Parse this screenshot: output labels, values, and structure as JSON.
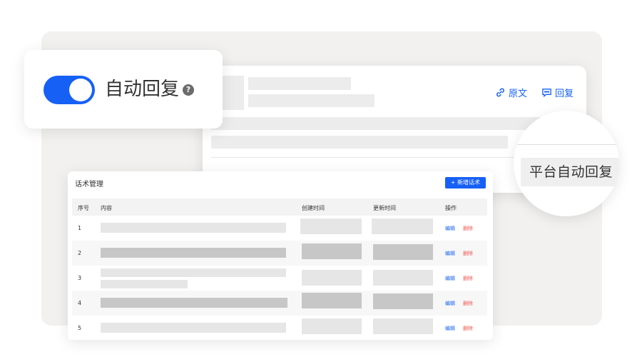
{
  "toggle": {
    "label": "自动回复",
    "on": true,
    "help_icon": "question-circle-icon"
  },
  "post": {
    "actions": [
      {
        "label": "原文",
        "icon": "link-icon"
      },
      {
        "label": "回复",
        "icon": "comment-icon"
      }
    ]
  },
  "magnifier": {
    "tag": "平台自动回复"
  },
  "script_table": {
    "title": "话术管理",
    "add_button": "+ 新增话术",
    "columns": {
      "index": "序号",
      "content": "内容",
      "created": "创建时间",
      "updated": "更新时间",
      "actions": "操作"
    },
    "rows": [
      {
        "index": "1",
        "edit": "编辑",
        "delete": "删除"
      },
      {
        "index": "2",
        "edit": "编辑",
        "delete": "删除"
      },
      {
        "index": "3",
        "edit": "编辑",
        "delete": "删除"
      },
      {
        "index": "4",
        "edit": "编辑",
        "delete": "删除"
      },
      {
        "index": "5",
        "edit": "编辑",
        "delete": "删除"
      }
    ]
  },
  "colors": {
    "accent": "#1660f5",
    "danger": "#f2554f"
  }
}
